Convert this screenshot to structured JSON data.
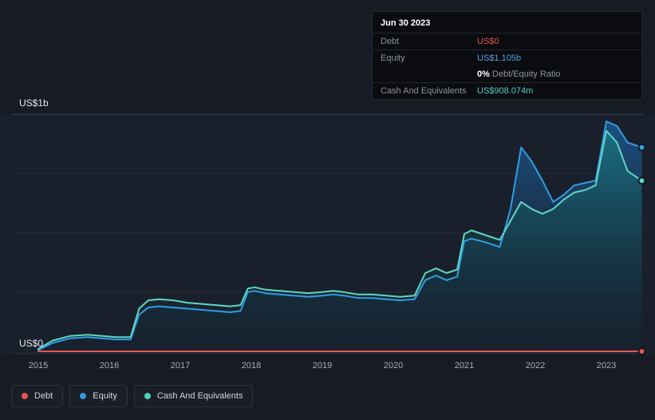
{
  "tooltip": {
    "date": "Jun 30 2023",
    "debt_label": "Debt",
    "debt_value": "US$0",
    "equity_label": "Equity",
    "equity_value": "US$1.105b",
    "ratio_bold": "0%",
    "ratio_rest": "Debt/Equity Ratio",
    "cash_label": "Cash And Equivalents",
    "cash_value": "US$908.074m"
  },
  "legend": [
    {
      "label": "Debt",
      "color": "#e8554e"
    },
    {
      "label": "Equity",
      "color": "#3598e2"
    },
    {
      "label": "Cash And Equivalents",
      "color": "#53cfbe"
    }
  ],
  "chart_data": {
    "type": "area",
    "title": "",
    "xlabel": "",
    "ylabel": "",
    "y_axis_labels": {
      "top": "US$1b",
      "bottom": "US$0"
    },
    "ylim": [
      0,
      1.08
    ],
    "y_unit": "US$ billions",
    "grid": "horizontal",
    "legend_position": "bottom-left",
    "minor_gridlines": [
      0.25,
      0.5,
      0.75
    ],
    "x_ticks": [
      "2015",
      "2016",
      "2017",
      "2018",
      "2019",
      "2020",
      "2021",
      "2022",
      "2023"
    ],
    "x": [
      2015.0,
      2015.2,
      2015.45,
      2015.7,
      2015.9,
      2016.1,
      2016.3,
      2016.42,
      2016.55,
      2016.7,
      2016.9,
      2017.1,
      2017.3,
      2017.5,
      2017.7,
      2017.85,
      2017.95,
      2018.05,
      2018.2,
      2018.4,
      2018.6,
      2018.8,
      2019.0,
      2019.15,
      2019.3,
      2019.5,
      2019.7,
      2019.9,
      2020.1,
      2020.3,
      2020.45,
      2020.6,
      2020.75,
      2020.9,
      2021.0,
      2021.1,
      2021.3,
      2021.5,
      2021.65,
      2021.8,
      2021.95,
      2022.1,
      2022.25,
      2022.4,
      2022.55,
      2022.7,
      2022.85,
      2023.0,
      2023.15,
      2023.3,
      2023.5
    ],
    "series": [
      {
        "key": "debt",
        "name": "Debt",
        "color": "#e8554e",
        "fill": false,
        "x": [
          2015.0,
          2023.5
        ],
        "values": [
          0,
          0
        ]
      },
      {
        "key": "equity",
        "name": "Equity",
        "color": "#2f9de4",
        "fill": true,
        "fill_from": "#1f78c8",
        "fill_to": "#0e2238",
        "fill_opacity_top": 0.55,
        "fill_opacity_bottom": 0.15,
        "values": [
          0.005,
          0.035,
          0.055,
          0.06,
          0.055,
          0.05,
          0.05,
          0.155,
          0.185,
          0.19,
          0.185,
          0.18,
          0.175,
          0.17,
          0.165,
          0.17,
          0.25,
          0.255,
          0.245,
          0.24,
          0.235,
          0.23,
          0.235,
          0.24,
          0.235,
          0.225,
          0.225,
          0.22,
          0.215,
          0.22,
          0.3,
          0.32,
          0.3,
          0.315,
          0.465,
          0.475,
          0.46,
          0.44,
          0.6,
          0.86,
          0.8,
          0.72,
          0.63,
          0.66,
          0.7,
          0.71,
          0.72,
          0.97,
          0.95,
          0.88,
          0.86
        ]
      },
      {
        "key": "cash",
        "name": "Cash And Equivalents",
        "color": "#5fd6c5",
        "fill": true,
        "fill_from": "#17a08e",
        "fill_to": "#0c2a2e",
        "fill_opacity_top": 0.4,
        "fill_opacity_bottom": 0.1,
        "values": [
          0.01,
          0.045,
          0.065,
          0.07,
          0.065,
          0.06,
          0.06,
          0.18,
          0.215,
          0.22,
          0.215,
          0.205,
          0.2,
          0.195,
          0.19,
          0.195,
          0.265,
          0.27,
          0.26,
          0.255,
          0.25,
          0.245,
          0.25,
          0.255,
          0.25,
          0.24,
          0.24,
          0.235,
          0.23,
          0.235,
          0.33,
          0.35,
          0.33,
          0.345,
          0.495,
          0.51,
          0.49,
          0.47,
          0.55,
          0.63,
          0.6,
          0.58,
          0.6,
          0.64,
          0.67,
          0.68,
          0.7,
          0.93,
          0.88,
          0.76,
          0.72
        ]
      }
    ]
  }
}
